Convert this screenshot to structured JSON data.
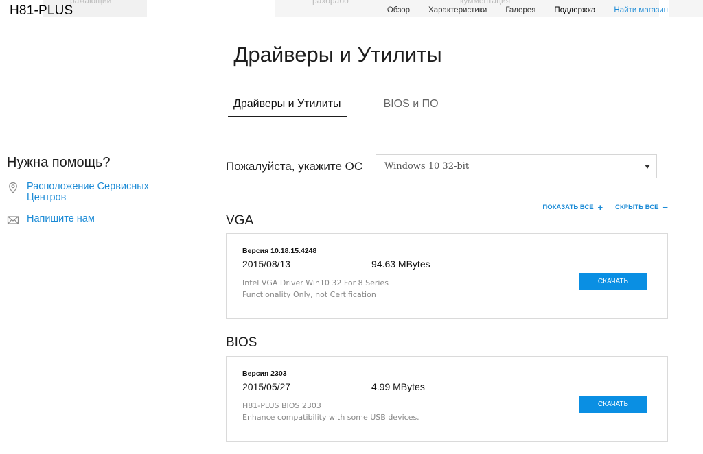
{
  "header": {
    "brand": "H81-PLUS",
    "nav": [
      {
        "label": "Обзор"
      },
      {
        "label": "Характеристики"
      },
      {
        "label": "Галерея"
      },
      {
        "label": "Поддержка"
      },
      {
        "label": "Найти магазин"
      }
    ],
    "ghost": [
      "ражающий",
      "рахорабо",
      "кумментация"
    ]
  },
  "page": {
    "title": "Драйверы и Утилиты",
    "tabs": [
      {
        "label": "Драйверы и Утилиты"
      },
      {
        "label": "BIOS и ПО"
      }
    ]
  },
  "sidebar": {
    "help_title": "Нужна помощь?",
    "links": [
      {
        "label": "Расположение Сервисных Центров",
        "icon": "location-pin-icon"
      },
      {
        "label": "Напишите нам",
        "icon": "envelope-icon"
      }
    ]
  },
  "os": {
    "label": "Пожалуйста, укажите ОС",
    "selected": "Windows 10 32-bit"
  },
  "toggles": {
    "show_all": "ПОКАЗАТЬ ВСЕ",
    "hide_all": "СКРЫТЬ ВСЕ"
  },
  "sections": [
    {
      "title": "VGA",
      "version": "Версия 10.18.15.4248",
      "date": "2015/08/13",
      "size": "94.63 MBytes",
      "desc1": "Intel VGA Driver Win10 32 For 8 Series",
      "desc2": "Functionality Only, not Certification",
      "download": "СКАЧАТЬ"
    },
    {
      "title": "BIOS",
      "version": "Версия 2303",
      "date": "2015/05/27",
      "size": "4.99 MBytes",
      "desc1": "H81-PLUS BIOS 2303",
      "desc2": "Enhance compatibility with some USB devices.",
      "download": "СКАЧАТЬ"
    }
  ],
  "colors": {
    "accent": "#1c8bd6",
    "button": "#0a8fe3"
  }
}
